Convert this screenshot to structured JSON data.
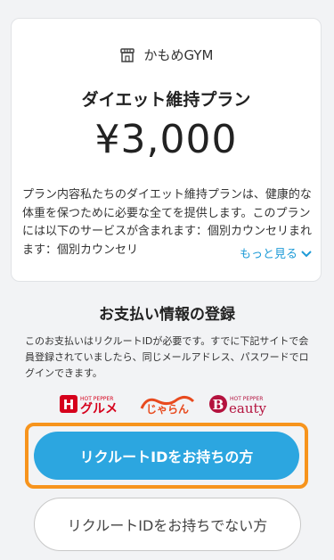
{
  "plan_card": {
    "store_icon": "store-icon",
    "store_name": "かもめGYM",
    "plan_title": "ダイエット維持プラン",
    "price": "¥3,000",
    "description": "プラン内容私たちのダイエット維持プランは、健康的な体重を保つために必要な全てを提供します。このプランには以下のサービスが含まれます：個別カウンセリまれます：個別カウンセリ",
    "more_label": "もっと見る",
    "more_icon": "chevron-down-icon",
    "accent_color": "#1e9bd7"
  },
  "payment": {
    "section_title": "お支払い情報の登録",
    "note": "このお支払いはリクルートIDが必要です。すでに下記サイトで会員登録されていましたら、同じメールアドレス、パスワードでログインできます。",
    "logos": {
      "gourmet_small": "HOT PEPPER",
      "gourmet_main": "グルメ",
      "jalan": "じゃらん",
      "beauty_small": "HOT PEPPER",
      "beauty_main": "eauty"
    },
    "primary_button": "リクルートIDをお持ちの方",
    "secondary_button": "リクルートIDをお持ちでない方",
    "primary_color": "#2ca6e0",
    "highlight_color": "#f7941d"
  }
}
